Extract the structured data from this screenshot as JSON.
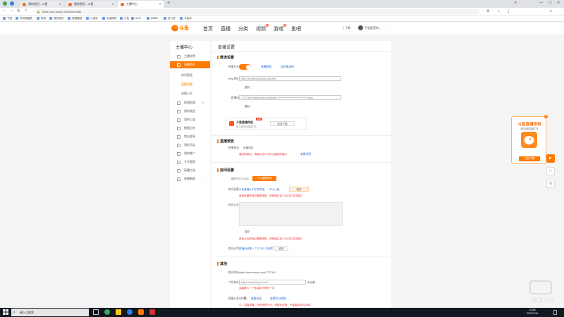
{
  "browser": {
    "tabs": [
      {
        "label": "我的首页 - 斗鱼"
      },
      {
        "label": "我的首页 - 斗鱼"
      },
      {
        "label": "主播中心"
      }
    ],
    "url": "https://mp.douyu.com/live/main",
    "bookmarks": [
      "书签",
      "本机收藏夹",
      "常用",
      "我的首页",
      "视频播放",
      "小游戏",
      "手游推荐",
      "斗鱼",
      "iQIYI",
      "BiliBili",
      "名人堂",
      "斗鱼前"
    ]
  },
  "site": {
    "logo_text": "斗鱼",
    "nav": [
      {
        "label": "首页"
      },
      {
        "label": "直播"
      },
      {
        "label": "分类"
      },
      {
        "label": "视频",
        "badge": "N"
      },
      {
        "label": "游戏",
        "badge": "N"
      },
      {
        "label": "鱼吧"
      }
    ],
    "download": "下载",
    "user": "不会配音的..."
  },
  "sidebar": {
    "title": "主播中心",
    "items": [
      {
        "label": "主播学院",
        "sub": []
      },
      {
        "label": "直播相关",
        "active": true,
        "sub": [
          {
            "label": "房间管理"
          },
          {
            "label": "直播设置",
            "current": true
          },
          {
            "label": "直播公告"
          }
        ]
      },
      {
        "label": "视频剪辑"
      },
      {
        "label": "我的收益"
      },
      {
        "label": "我的公会"
      },
      {
        "label": "数据分析"
      },
      {
        "label": "商业变现"
      },
      {
        "label": "我的活动"
      },
      {
        "label": "我的推广"
      },
      {
        "label": "专注管理"
      },
      {
        "label": "直播工具"
      },
      {
        "label": "直播数据"
      }
    ]
  },
  "main": {
    "page_title": "直播设置",
    "push": {
      "section": "推流设置",
      "live_switch_label": "直播开关:",
      "live_switch_link": "直播教程",
      "live_switch_link2": "没有推流码",
      "rtmp_label": "rtmp地址:",
      "rtmp_value": "rtmp://sendfc3a.douyu.com/live",
      "copy": "复制",
      "code_label": "直播码:",
      "code_value": "7727181rPlsb4bJWg?wsSecret=******************************&wsi",
      "copy2": "复制",
      "tool_name": "斗鱼直播伴侣",
      "tool_desc": "官方推荐的直播工具",
      "tool_badge": "NEW",
      "tool_download": "前往下载"
    },
    "preview": {
      "section": "直播预告",
      "label": "直播预告:",
      "btn": "设置预告",
      "warn": "通过审核后，将展示在7/10内主播房间展示",
      "link": "查看说明"
    },
    "room": {
      "section": "房间设置",
      "room_id_label": "房间号:",
      "room_id": "7727181",
      "room_id_btn": "个人直播房间",
      "title_label": "房间标题:",
      "title_value": "斗鱼直播从不在意排版，一不小心就...",
      "title_btn": "保存",
      "title_warn": "房间标题修改后需要审核，审核通过后7/10内生效并展示",
      "notice_label": "房间公告:",
      "save": "保存",
      "notice_warn": "房间公告修改后需要审核，审核通过后7/10内生效并展示",
      "category_label": "房间分类:",
      "category_value": "直播间设置 > 7727181 次权限",
      "category_btn": "修改"
    },
    "other": {
      "section": "其他",
      "addr_label": "房间地址:",
      "addr_value": "https://www.douyu.com/7727181",
      "domain_label": "个性域名:",
      "domain_value": "https://www.douyu.com/",
      "domain_suffix": "未设置",
      "domain_warn": "温馨提示：个性域名可修改一次",
      "level_label": "直播公会:",
      "level_value": "12 级",
      "level_link": "查看权益",
      "level_link2": "查看积分规则",
      "level_warn": "注：温馨提醒，如有违规行为，视规定处理，严重者将永久封禁。"
    }
  },
  "promo": {
    "title": "斗鱼直播伴侣",
    "subtitle": "超好用的直播工具",
    "btn": "立即下载"
  },
  "taskbar": {
    "search": "键入以搜索",
    "time": "23:58",
    "date": "2021/7/19"
  }
}
